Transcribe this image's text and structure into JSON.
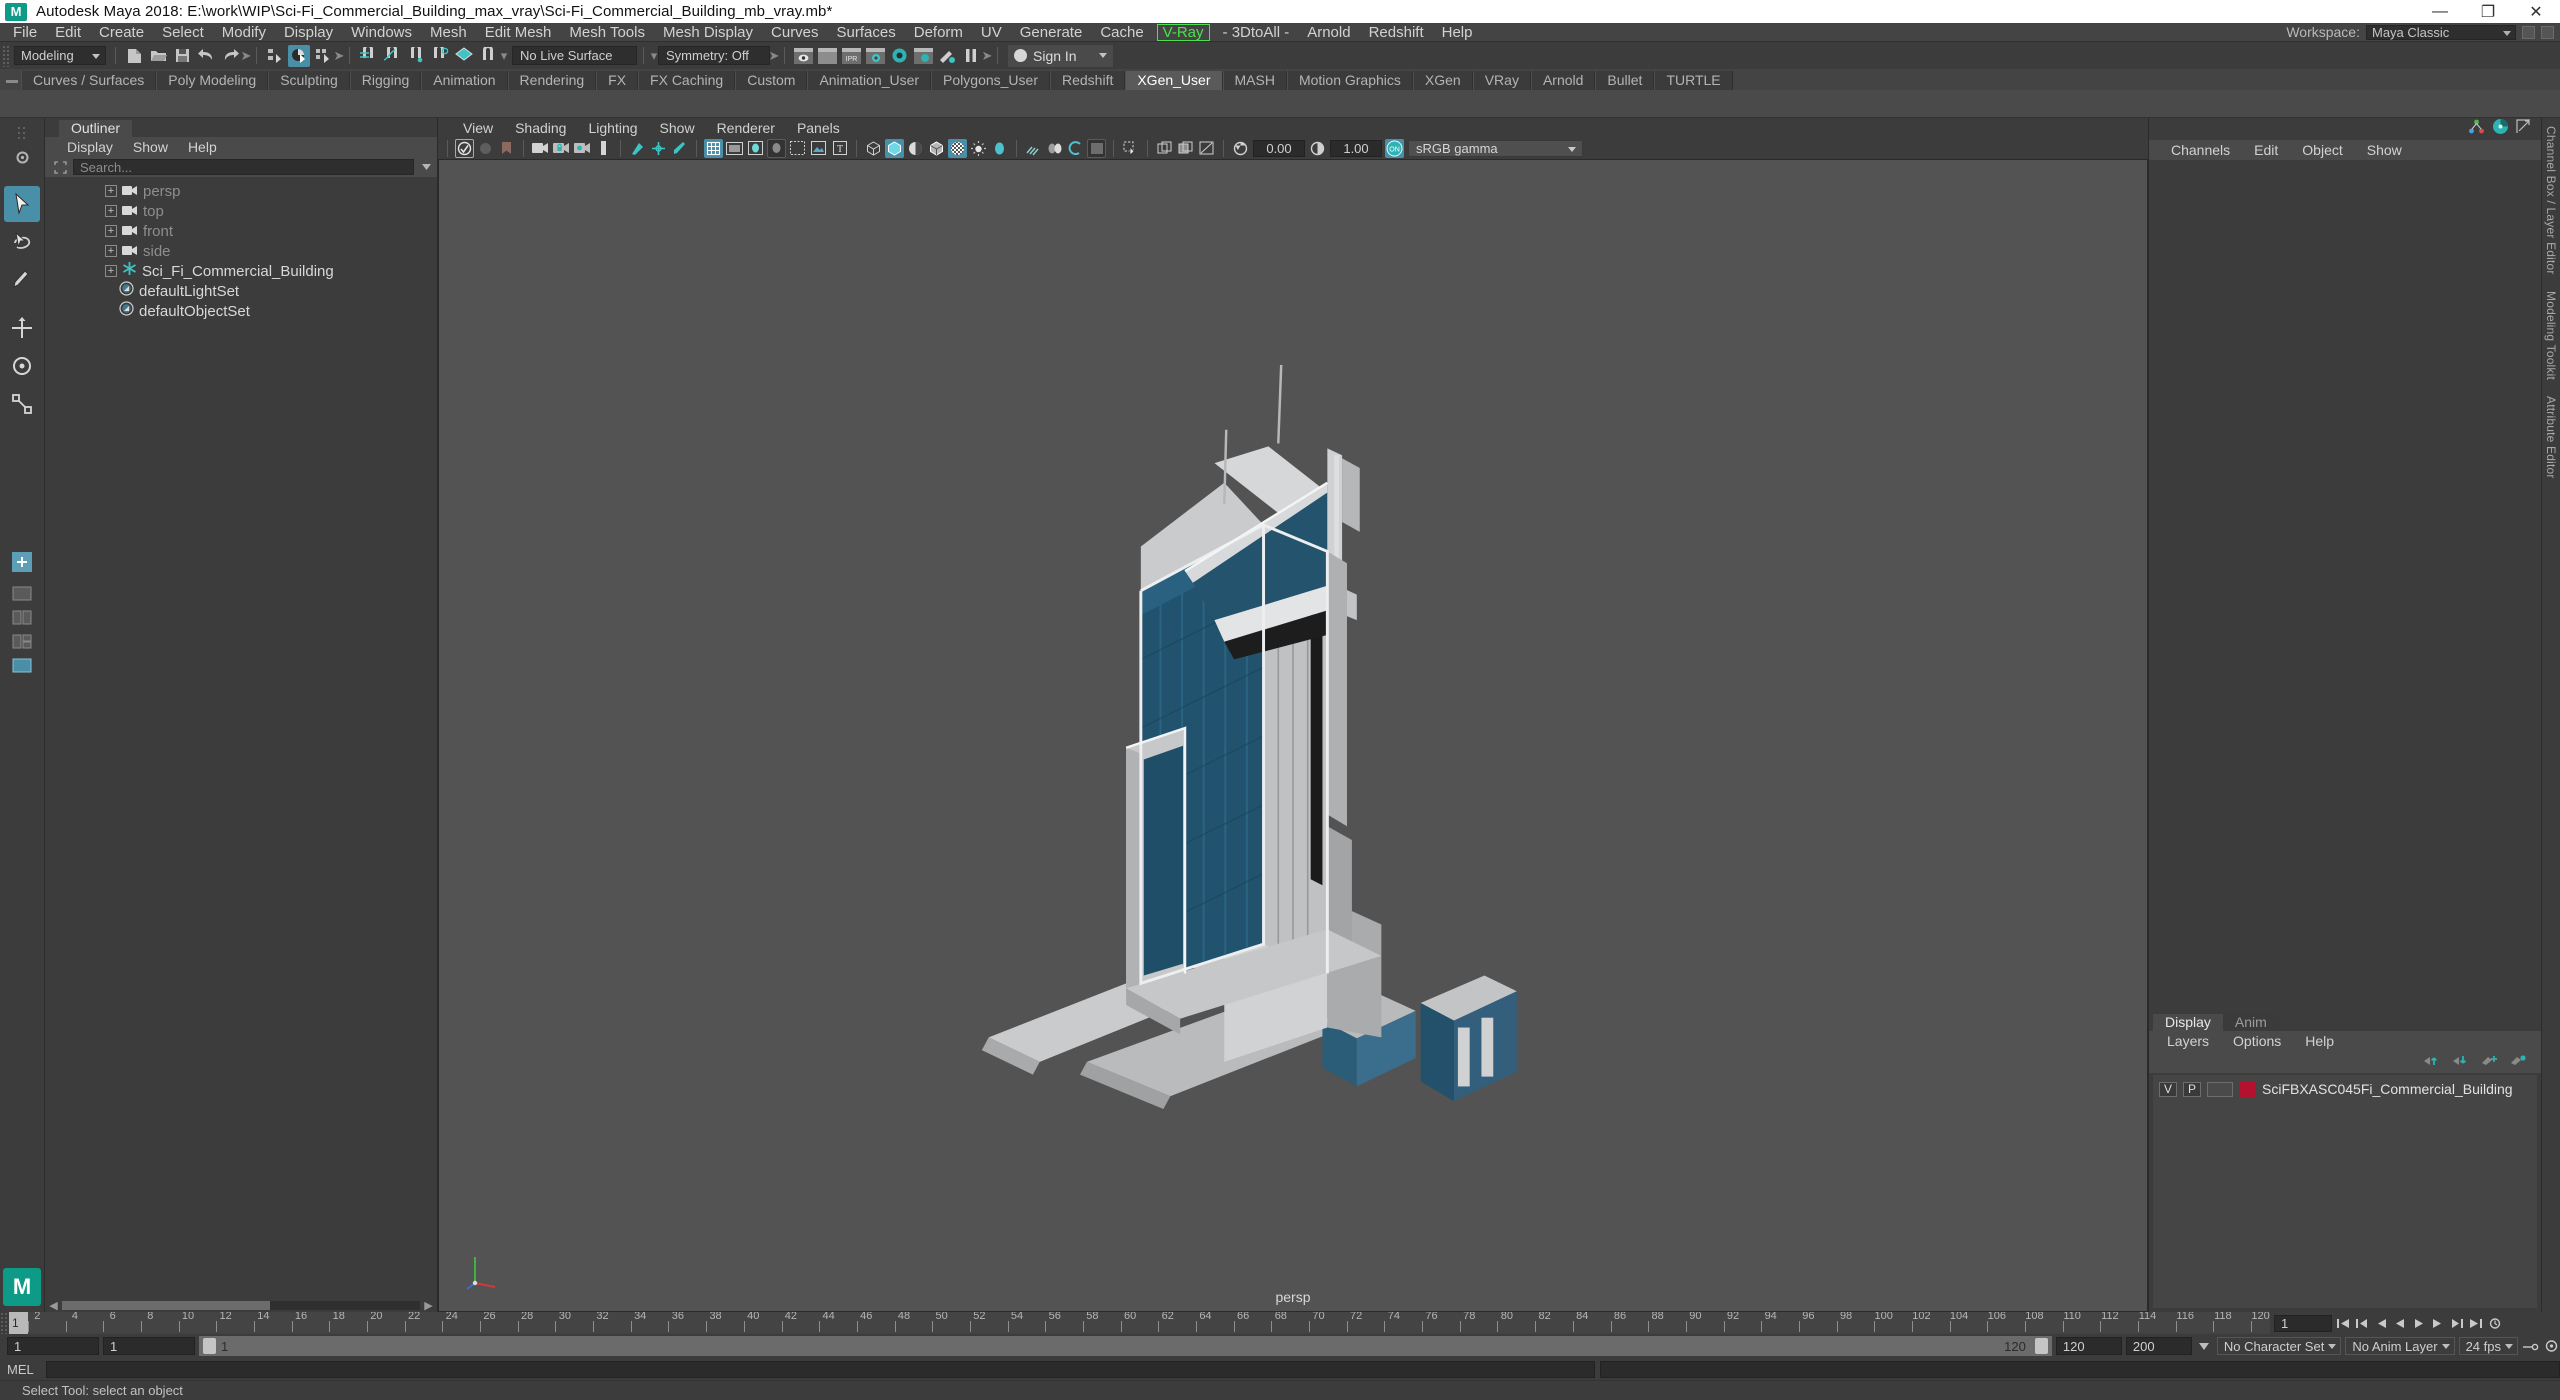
{
  "titlebar": {
    "logo": "maya-logo-icon",
    "title": "Autodesk Maya 2018: E:\\work\\WIP\\Sci-Fi_Commercial_Building_max_vray\\Sci-Fi_Commercial_Building_mb_vray.mb*",
    "minimize": "—",
    "maximize": "❐",
    "close": "✕"
  },
  "menubar": {
    "items": [
      "File",
      "Edit",
      "Create",
      "Select",
      "Modify",
      "Display",
      "Windows",
      "Mesh",
      "Edit Mesh",
      "Mesh Tools",
      "Mesh Display",
      "Curves",
      "Surfaces",
      "Deform",
      "UV",
      "Generate",
      "Cache"
    ],
    "vray": "V-Ray",
    "items_after": [
      "- 3DtoAll -",
      "Arnold",
      "Redshift",
      "Help"
    ],
    "workspace_label": "Workspace:",
    "workspace_value": "Maya Classic"
  },
  "statusline": {
    "mode": "Modeling",
    "live_surface": "No Live Surface",
    "symmetry": "Symmetry: Off",
    "signin": "Sign In"
  },
  "shelf": {
    "tabs": [
      "Curves / Surfaces",
      "Poly Modeling",
      "Sculpting",
      "Rigging",
      "Animation",
      "Rendering",
      "FX",
      "FX Caching",
      "Custom",
      "Animation_User",
      "Polygons_User",
      "Redshift",
      "XGen_User",
      "MASH",
      "Motion Graphics",
      "XGen",
      "VRay",
      "Arnold",
      "Bullet",
      "TURTLE"
    ],
    "active": "XGen_User"
  },
  "outliner": {
    "tab": "Outliner",
    "menus": [
      "Display",
      "Show",
      "Help"
    ],
    "search_placeholder": "Search...",
    "items": [
      {
        "label": "persp",
        "icon": "camera-icon",
        "expandable": true,
        "dim": true
      },
      {
        "label": "top",
        "icon": "camera-icon",
        "expandable": true,
        "dim": true
      },
      {
        "label": "front",
        "icon": "camera-icon",
        "expandable": true,
        "dim": true
      },
      {
        "label": "side",
        "icon": "camera-icon",
        "expandable": true,
        "dim": true
      },
      {
        "label": "Sci_Fi_Commercial_Building",
        "icon": "transform-icon",
        "expandable": true,
        "dim": false
      },
      {
        "label": "defaultLightSet",
        "icon": "set-icon",
        "expandable": false,
        "dim": false
      },
      {
        "label": "defaultObjectSet",
        "icon": "set-icon",
        "expandable": false,
        "dim": false
      }
    ]
  },
  "viewport": {
    "menus": [
      "View",
      "Shading",
      "Lighting",
      "Show",
      "Renderer",
      "Panels"
    ],
    "exposure": "0.00",
    "gamma_value": "1.00",
    "color_profile": "sRGB gamma",
    "camera_label": "persp",
    "model_name": "Sci-Fi Commercial Building"
  },
  "rightpanel": {
    "menus": [
      "Channels",
      "Edit",
      "Object",
      "Show"
    ],
    "layer_tabs": [
      "Display",
      "Anim"
    ],
    "layer_active": "Display",
    "layer_menus": [
      "Layers",
      "Options",
      "Help"
    ],
    "layers": [
      {
        "visibility": "V",
        "playback": "P",
        "color": "#b3112e",
        "name": "SciFBXASC045Fi_Commercial_Building"
      }
    ],
    "vertical_tabs": [
      "Channel Box / Layer Editor",
      "Modeling Toolkit",
      "Attribute Editor"
    ]
  },
  "timeline": {
    "current_frame": "1",
    "ticks": [
      2,
      4,
      6,
      8,
      10,
      12,
      14,
      16,
      18,
      20,
      22,
      24,
      26,
      28,
      30,
      32,
      34,
      36,
      38,
      40,
      42,
      44,
      46,
      48,
      50,
      52,
      54,
      56,
      58,
      60,
      62,
      64,
      66,
      68,
      70,
      72,
      74,
      76,
      78,
      80,
      82,
      84,
      86,
      88,
      90,
      92,
      94,
      96,
      98,
      100,
      102,
      104,
      106,
      108,
      110,
      112,
      114,
      116,
      118,
      120
    ],
    "frame_field": "1"
  },
  "rangebar": {
    "start_field": "1",
    "range_start_field": "1",
    "slider_start": "1",
    "slider_end": "120",
    "end_a": "120",
    "end_b": "200",
    "character_set": "No Character Set",
    "anim_layer": "No Anim Layer",
    "fps": "24 fps"
  },
  "mel": {
    "label": "MEL",
    "command": ""
  },
  "statusbar": {
    "text": "Select Tool: select an object"
  },
  "colors": {
    "accent": "#4a8fa8",
    "vray_green": "#4ce24c",
    "layer_swatch": "#b3112e",
    "viewport_bg": "#535353",
    "building_glass": "#1f4f6b",
    "building_shell": "#c7c9cb"
  }
}
